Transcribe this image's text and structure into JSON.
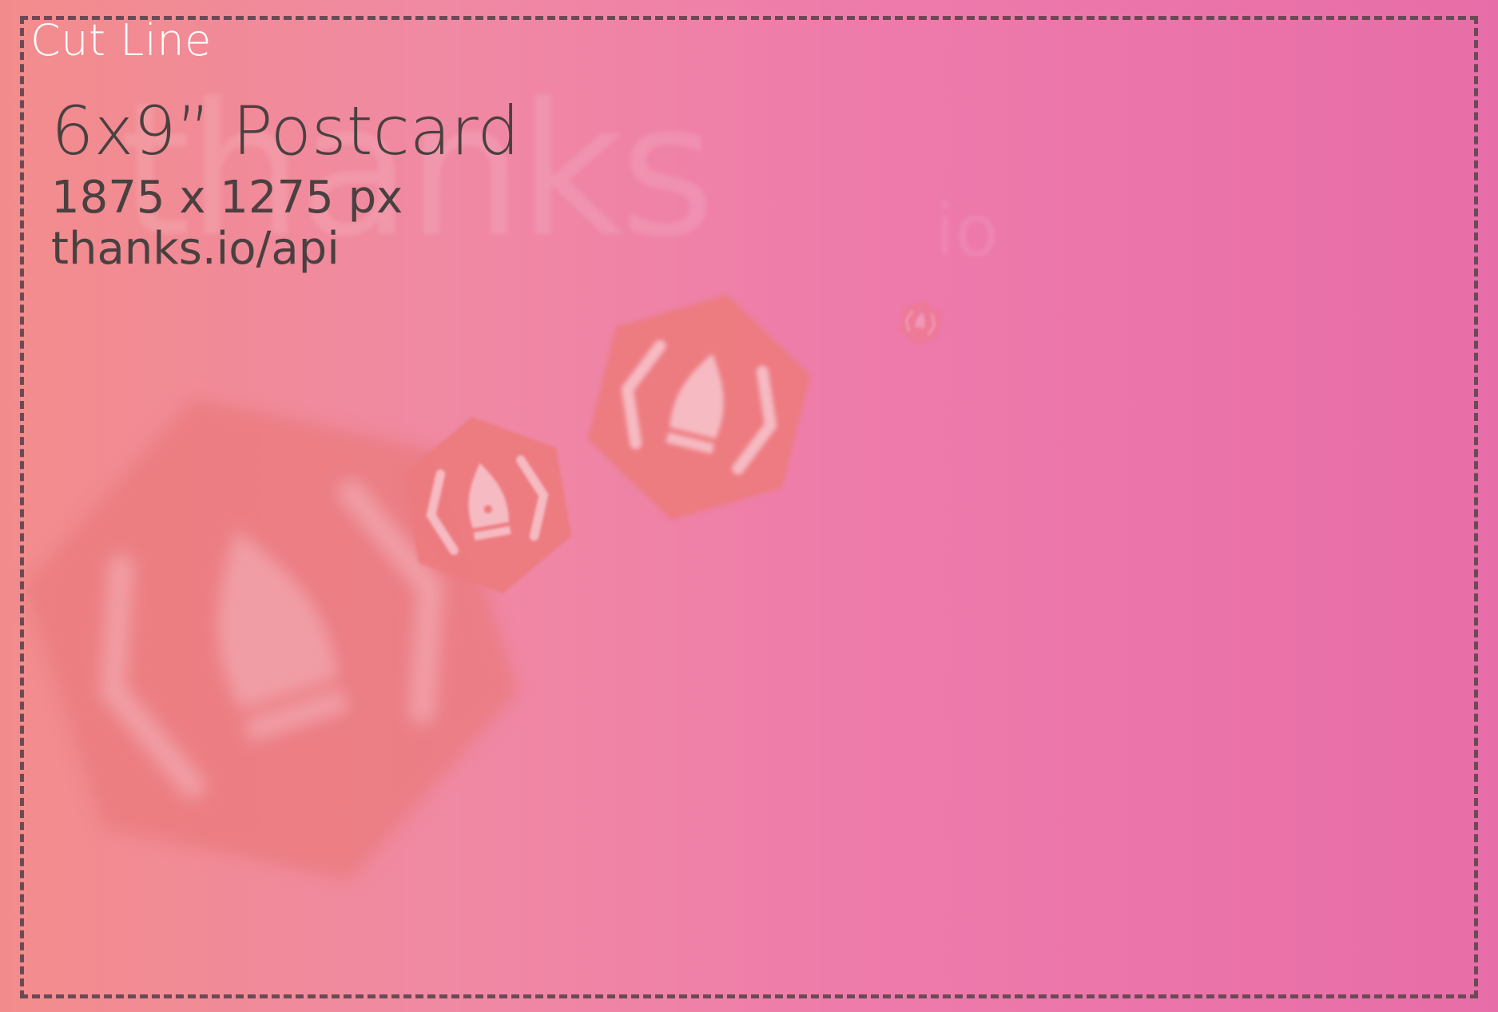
{
  "cut_line": {
    "label": "Cut Line",
    "color": "#6b4a55"
  },
  "card": {
    "title": "6x9” Postcard",
    "dimensions": "1875 x 1275 px",
    "url": "thanks.io/api"
  },
  "watermark": {
    "brand_main": "thanks",
    "brand_suffix": "io"
  },
  "colors": {
    "gradient_left": "#f28c8c",
    "gradient_right": "#e76da8",
    "logo_fill": "#ec7b7e",
    "text": "#4a4040"
  },
  "icons": [
    "pen-nib-hexagon-logo-icon"
  ]
}
